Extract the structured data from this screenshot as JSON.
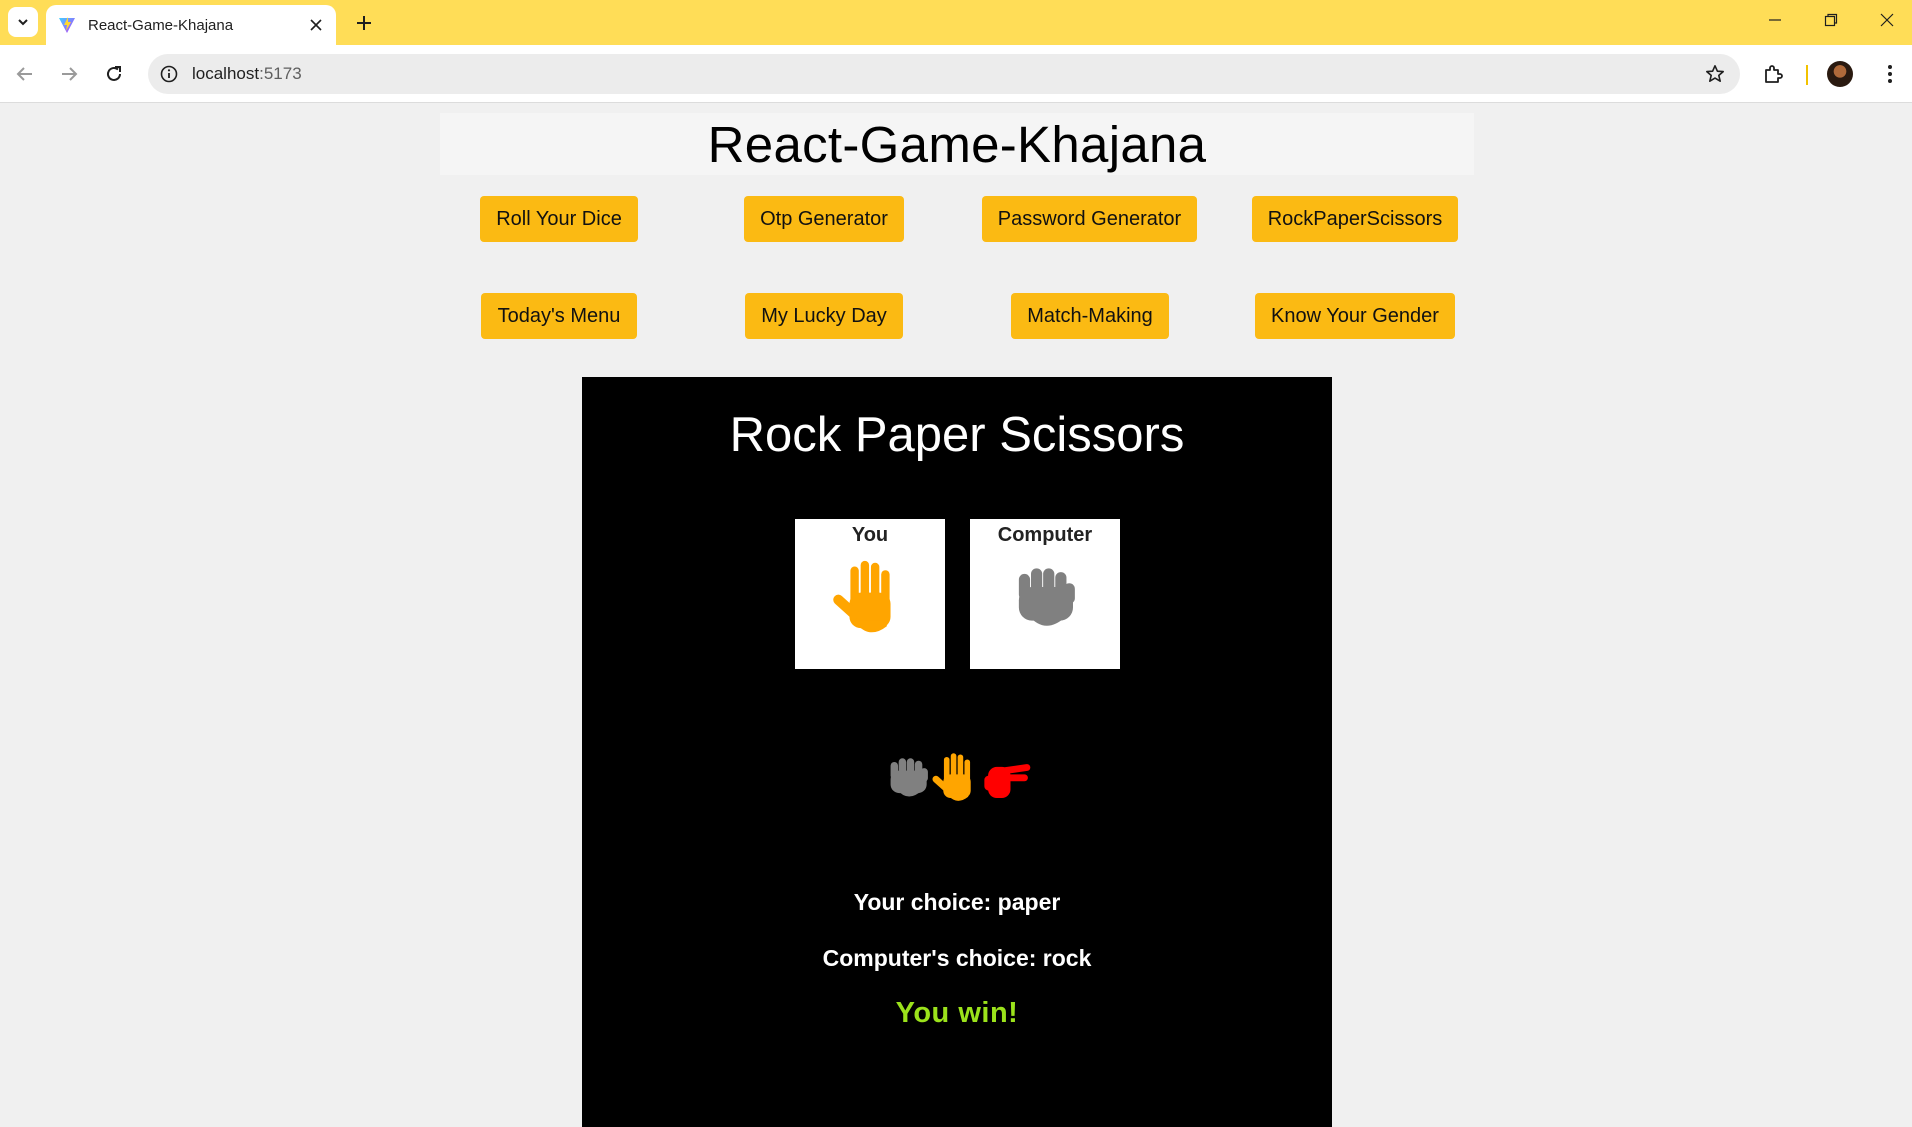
{
  "browser": {
    "tab_title": "React-Game-Khajana",
    "url_host": "localhost",
    "url_port": ":5173"
  },
  "app": {
    "title": "React-Game-Khajana",
    "nav_buttons": [
      "Roll Your Dice",
      "Otp Generator",
      "Password Generator",
      "RockPaperScissors",
      "Today's Menu",
      "My Lucky Day",
      "Match-Making",
      "Know Your Gender"
    ]
  },
  "game": {
    "title": "Rock Paper Scissors",
    "you_label": "You",
    "computer_label": "Computer",
    "your_choice_text": "Your choice: paper",
    "computer_choice_text": "Computer's choice: rock",
    "result_text": "You win!",
    "choice_icons": [
      "rock-icon",
      "paper-icon",
      "scissors-icon"
    ]
  },
  "colors": {
    "tabbar": "#ffdd57",
    "nav_button": "#fbba13",
    "paper_hand": "#ffa500",
    "rock_hand": "#808080",
    "scissors_hand": "#ff0000",
    "win_text": "#9be21b"
  }
}
